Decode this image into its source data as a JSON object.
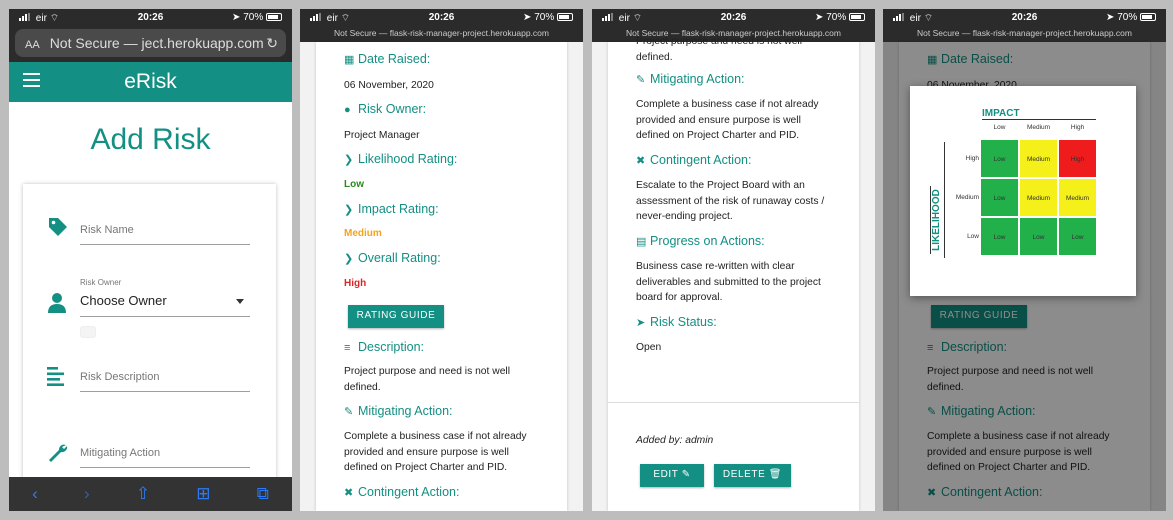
{
  "status": {
    "carrier": "eir",
    "time": "20:26",
    "battery": "70%"
  },
  "phone1": {
    "url_prefix": "AA",
    "url_text": "Not Secure — ject.herokuapp.com",
    "brand": "eRisk",
    "title": "Add Risk",
    "fields": {
      "risk_name_placeholder": "Risk Name",
      "risk_owner_label": "Risk Owner",
      "risk_owner_value": "Choose Owner",
      "risk_description_placeholder": "Risk Description",
      "mitigating_action_placeholder": "Mitigating Action"
    }
  },
  "url_small": "Not Secure — flask-risk-manager-project.herokuapp.com",
  "phone2": {
    "date_raised_label": "Date Raised:",
    "date_raised_value": "06 November, 2020",
    "risk_owner_label": "Risk Owner:",
    "risk_owner_value": "Project Manager",
    "likelihood_label": "Likelihood Rating:",
    "likelihood_value": "Low",
    "impact_label": "Impact Rating:",
    "impact_value": "Medium",
    "overall_label": "Overall Rating:",
    "overall_value": "High",
    "rating_guide_button": "RATING GUIDE",
    "description_label": "Description:",
    "description_value": "Project purpose and need is not well defined.",
    "mitigating_label": "Mitigating Action:",
    "mitigating_value": "Complete a business case if not already provided and ensure purpose is well defined on Project Charter and PID.",
    "contingent_label": "Contingent Action:"
  },
  "phone3": {
    "top_cut_text": "Project purpose and need is not well defined.",
    "mitigating_label": "Mitigating Action:",
    "mitigating_value": "Complete a business case if not already provided and ensure purpose is well defined on Project Charter and PID.",
    "contingent_label": "Contingent Action:",
    "contingent_value": "Escalate to the Project Board with an assessment of the risk of runaway costs / never-ending project.",
    "progress_label": "Progress on Actions:",
    "progress_value": "Business case re-written with clear deliverables and submitted to the project board for approval.",
    "status_label": "Risk Status:",
    "status_value": "Open",
    "added_by": "Added by: admin",
    "edit_button": "EDIT",
    "delete_button": "DELETE"
  },
  "phone4": {
    "date_raised_label": "Date Raised:",
    "date_raised_value": "06 November, 2020",
    "rating_guide_button": "RATING GUIDE",
    "description_label": "Description:",
    "description_value": "Project purpose and need is not well defined.",
    "mitigating_label": "Mitigating Action:",
    "mitigating_value": "Complete a business case if not already provided and ensure purpose is well defined on Project Charter and PID.",
    "contingent_label": "Contingent Action:",
    "matrix": {
      "impact_title": "IMPACT",
      "likelihood_title": "LIKELIHOOD",
      "col_headers": [
        "Low",
        "Medium",
        "High"
      ],
      "row_headers": [
        "High",
        "Medium",
        "Low"
      ],
      "cells": [
        [
          "Low",
          "Medium",
          "High"
        ],
        [
          "Low",
          "Medium",
          "Medium"
        ],
        [
          "Low",
          "Low",
          "Low"
        ]
      ],
      "colors": {
        "Low": "#22b04b",
        "Medium": "#f5f01a",
        "High": "#ee1c1c"
      }
    }
  },
  "colors": {
    "accent": "#138f83",
    "low": "#2a8a1f",
    "medium": "#f5a31a",
    "high": "#dc2626"
  }
}
